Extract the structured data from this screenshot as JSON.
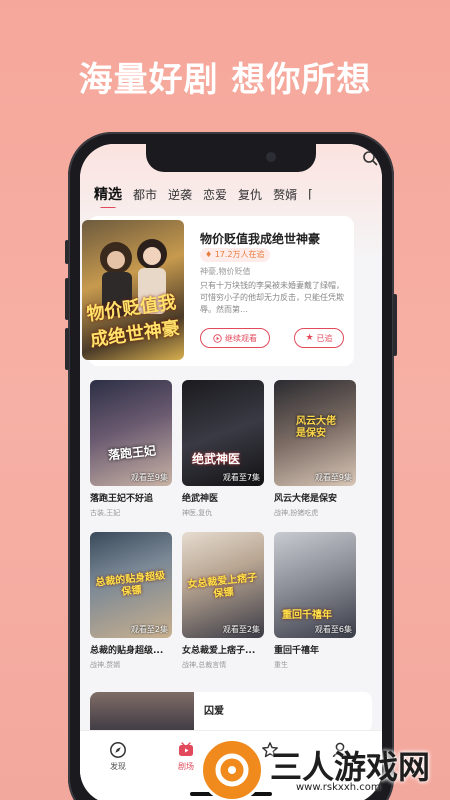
{
  "headline": "海量好剧 想你所想",
  "tabs": [
    "精选",
    "都市",
    "逆袭",
    "恋爱",
    "复仇",
    "赘婿"
  ],
  "featured": {
    "title": "物价贬值我成绝世神豪",
    "followers": "17.2万人在追",
    "tags": "神豪,物价贬值",
    "description": "只有十万块钱的李昊被未婚妻戴了绿帽，可惜穷小子的他却无力反击，只能任凭欺辱。然而第…",
    "cover_text": "物价贬值我成绝世神豪",
    "continue_label": "继续观看",
    "followed_label": "已追"
  },
  "cards": [
    {
      "title": "落跑王妃不好追",
      "tags": "古装,王妃",
      "progress": "观看至9集",
      "cover_text": "落跑王妃"
    },
    {
      "title": "绝武神医",
      "tags": "神医,复仇",
      "progress": "观看至7集",
      "cover_text": "绝武神医"
    },
    {
      "title": "风云大佬是保安",
      "tags": "战神,扮猪吃虎",
      "progress": "观看至9集",
      "cover_text": "风云大佬是保安"
    },
    {
      "title": "总裁的贴身超级...",
      "tags": "战神,赘婿",
      "progress": "观看至2集",
      "cover_text": "总裁的贴身超级保镖"
    },
    {
      "title": "女总裁爱上痞子...",
      "tags": "战神,总裁言情",
      "progress": "观看至2集",
      "cover_text": "女总裁爱上痞子保镖"
    },
    {
      "title": "重回千禧年",
      "tags": "重生",
      "progress": "观看至6集",
      "cover_text": "重回千禧年"
    }
  ],
  "bottom_card": {
    "title": "囚爱"
  },
  "nav": [
    {
      "label": "发现",
      "icon": "compass-icon"
    },
    {
      "label": "剧场",
      "icon": "theater-icon"
    },
    {
      "label": "",
      "icon": "star-icon"
    },
    {
      "label": "",
      "icon": "user-icon"
    }
  ],
  "watermark": {
    "title": "三人游戏网",
    "url": "www.rskxxh.com"
  },
  "colors": {
    "accent": "#e24a5c",
    "background": "#f6a79b",
    "badge_text": "#e97c3d"
  }
}
